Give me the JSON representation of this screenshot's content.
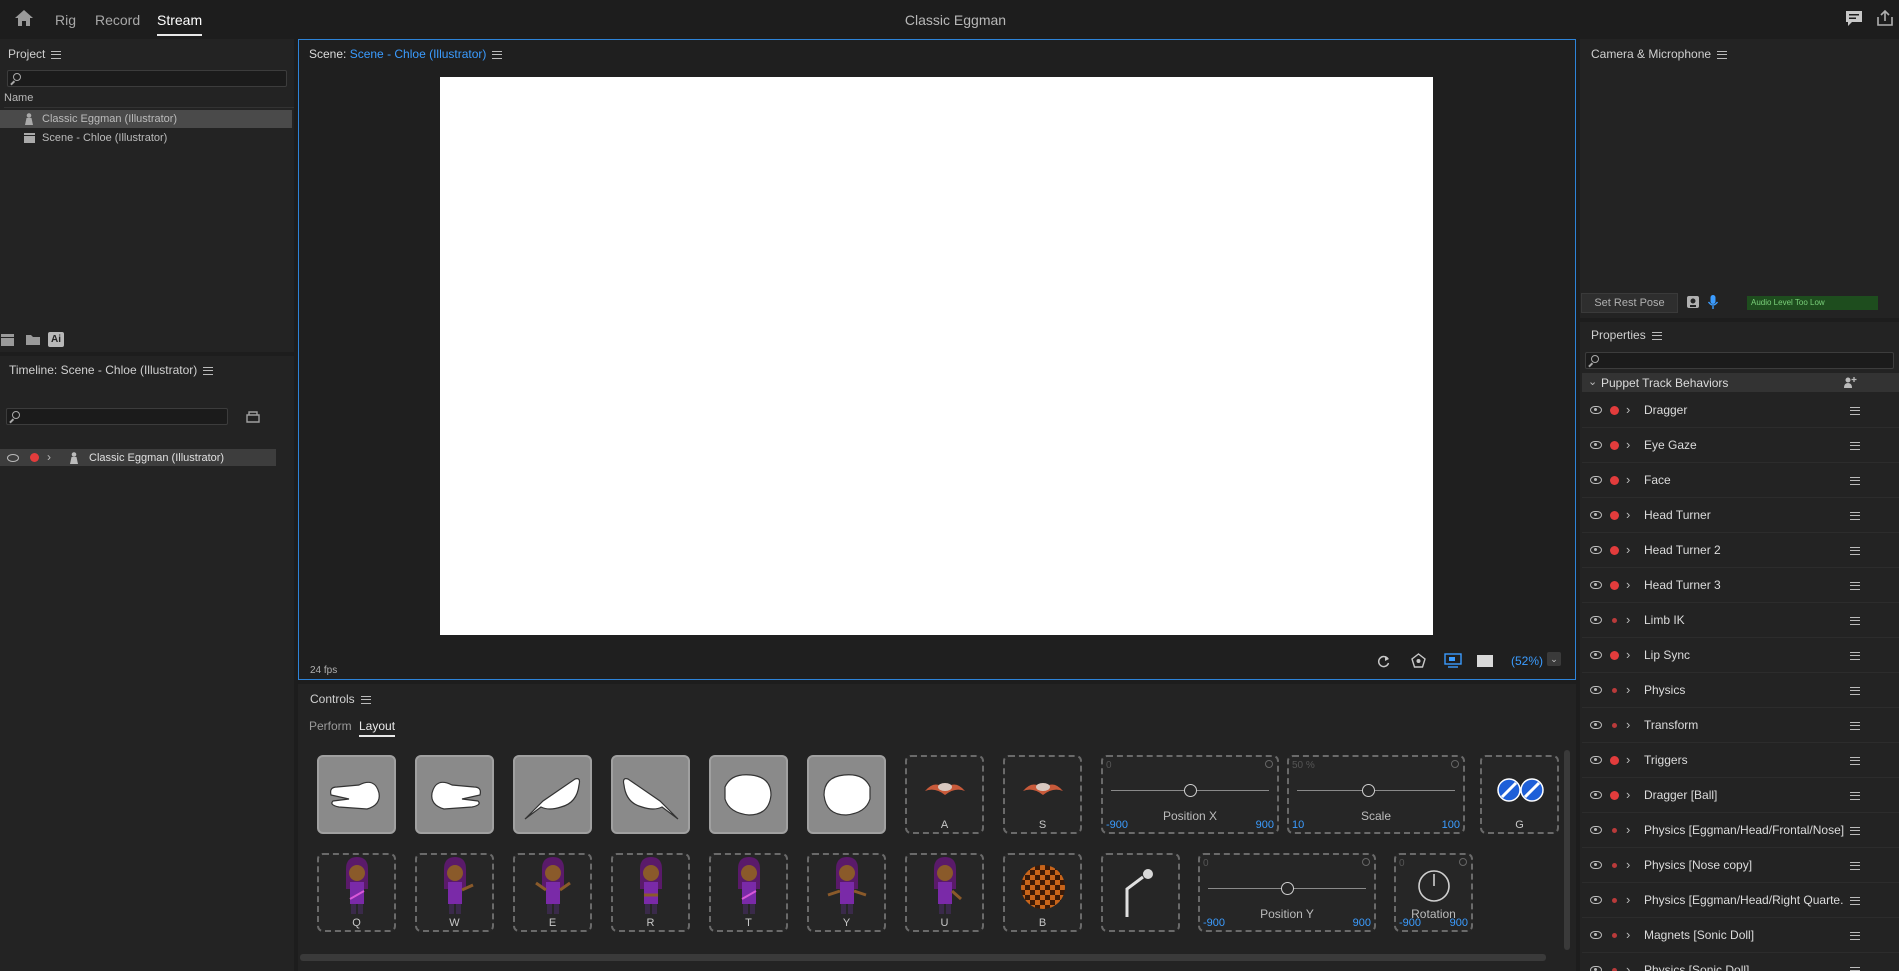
{
  "app": {
    "title": "Classic Eggman",
    "tabs": [
      {
        "label": "Rig"
      },
      {
        "label": "Record"
      },
      {
        "label": "Stream"
      }
    ],
    "active_tab": "Stream",
    "icons": [
      "home-icon",
      "feedback-icon",
      "share-icon"
    ]
  },
  "project": {
    "title": "Project",
    "column_name": "Name",
    "items": [
      {
        "label": "Classic Eggman (Illustrator)",
        "icon": "puppet-icon",
        "selected": true
      },
      {
        "label": "Scene - Chloe (Illustrator)",
        "icon": "scene-icon",
        "selected": false
      }
    ],
    "footer_icons": [
      "new-scene-icon",
      "folder-icon",
      "ai-import-icon"
    ],
    "ai_label": "Ai"
  },
  "timeline": {
    "title": "Timeline: Scene - Chloe (Illustrator)",
    "track": {
      "label": "Classic Eggman (Illustrator)"
    }
  },
  "scene": {
    "prefix": "Scene:",
    "name": "Scene - Chloe (Illustrator)",
    "fps": "24 fps",
    "zoom": "(52%)"
  },
  "camera": {
    "title": "Camera & Microphone",
    "rest_pose_button": "Set Rest Pose",
    "audio_status": "Audio Level Too Low"
  },
  "properties": {
    "title": "Properties",
    "section": "Puppet Track Behaviors",
    "behaviors": [
      {
        "label": "Dragger",
        "armed": true
      },
      {
        "label": "Eye Gaze",
        "armed": true
      },
      {
        "label": "Face",
        "armed": true
      },
      {
        "label": "Head Turner",
        "armed": true
      },
      {
        "label": "Head Turner 2",
        "armed": true
      },
      {
        "label": "Head Turner 3",
        "armed": true
      },
      {
        "label": "Limb IK",
        "armed": false
      },
      {
        "label": "Lip Sync",
        "armed": true
      },
      {
        "label": "Physics",
        "armed": false
      },
      {
        "label": "Transform",
        "armed": false
      },
      {
        "label": "Triggers",
        "armed": true
      },
      {
        "label": "Dragger [Ball]",
        "armed": true
      },
      {
        "label": "Physics [Eggman/Head/Frontal/Nose]",
        "armed": false
      },
      {
        "label": "Physics [Nose copy]",
        "armed": false
      },
      {
        "label": "Physics [Eggman/Head/Right Quarte...",
        "armed": false
      },
      {
        "label": "Magnets [Sonic Doll]",
        "armed": false
      },
      {
        "label": "Physics [Sonic Doll]",
        "armed": false
      }
    ]
  },
  "controls": {
    "title": "Controls",
    "tabs": [
      {
        "label": "Perform"
      },
      {
        "label": "Layout"
      }
    ],
    "active_tab": "Layout",
    "row1_keys": {
      "a": "A",
      "s": "S",
      "g": "G"
    },
    "row2_keys": [
      "Q",
      "W",
      "E",
      "R",
      "T",
      "Y",
      "U",
      "B"
    ],
    "sliders": {
      "position_x": {
        "name": "Position X",
        "min": "-900",
        "max": "900",
        "current": "0"
      },
      "scale": {
        "name": "Scale",
        "min": "10",
        "max": "100",
        "current": "50 %"
      },
      "position_y": {
        "name": "Position Y",
        "min": "-900",
        "max": "900",
        "current": "0"
      },
      "rotation": {
        "name": "Rotation",
        "min": "-900",
        "max": "900",
        "current": "0"
      }
    }
  },
  "colors": {
    "accent": "#3b9cff",
    "record": "#e23c3c",
    "audio_status": "#1e4d1e"
  }
}
